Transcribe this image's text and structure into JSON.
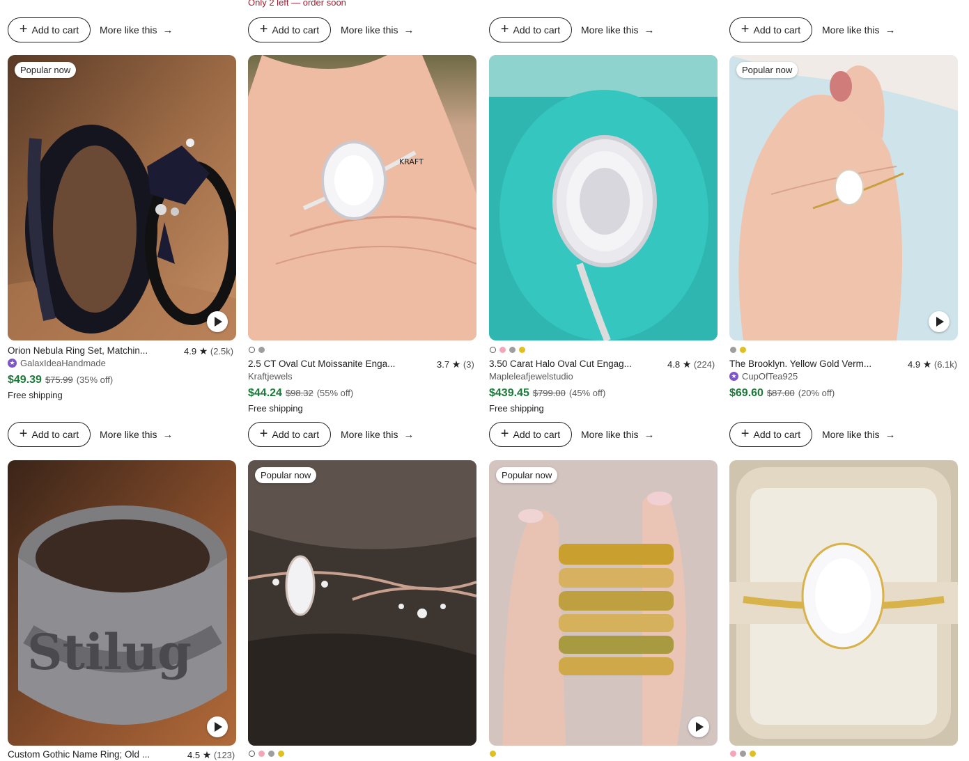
{
  "stock_note": "Only 2 left — order soon",
  "buttons": {
    "add_to_cart": "Add to cart",
    "more_like_this": "More like this"
  },
  "listings": [
    {
      "badge": "Popular now",
      "video": true,
      "swatches": [],
      "title": "Orion Nebula Ring Set, Matchin...",
      "rating": "4.9",
      "review_count": "(2.5k)",
      "shop": "GalaxIdeaHandmade",
      "star_seller": true,
      "price": "$49.39",
      "original_price": "$75.99",
      "discount": "(35% off)",
      "shipping": "Free shipping"
    },
    {
      "badge": "",
      "video": false,
      "swatches": [
        "#ffffff",
        "#9e9e9e"
      ],
      "title": "2.5 CT Oval Cut Moissanite Enga...",
      "rating": "3.7",
      "review_count": "(3)",
      "shop": "Kraftjewels",
      "star_seller": false,
      "price": "$44.24",
      "original_price": "$98.32",
      "discount": "(55% off)",
      "shipping": "Free shipping"
    },
    {
      "badge": "",
      "video": false,
      "swatches": [
        "#ffffff",
        "#f4a6b8",
        "#9e9e9e",
        "#e0c020"
      ],
      "title": "3.50 Carat Halo Oval Cut Engag...",
      "rating": "4.8",
      "review_count": "(224)",
      "shop": "Mapleleafjewelstudio",
      "star_seller": false,
      "price": "$439.45",
      "original_price": "$799.00",
      "discount": "(45% off)",
      "shipping": "Free shipping"
    },
    {
      "badge": "Popular now",
      "video": true,
      "swatches": [
        "#9e9e9e",
        "#e0c020"
      ],
      "title": "The Brooklyn. Yellow Gold Verm...",
      "rating": "4.9",
      "review_count": "(6.1k)",
      "shop": "CupOfTea925",
      "star_seller": true,
      "price": "$69.60",
      "original_price": "$87.00",
      "discount": "(20% off)",
      "shipping": ""
    },
    {
      "badge": "",
      "video": true,
      "swatches": [],
      "title": "Custom Gothic Name Ring; Old ...",
      "rating": "4.5",
      "review_count": "(123)"
    },
    {
      "badge": "Popular now",
      "video": false,
      "swatches": [
        "#ffffff",
        "#f4a6b8",
        "#9e9e9e",
        "#e0c020"
      ]
    },
    {
      "badge": "Popular now",
      "video": true,
      "swatches": [
        "#e0c020"
      ]
    },
    {
      "badge": "",
      "video": false,
      "swatches": [
        "#f4a6b8",
        "#9e9e9e",
        "#e0c020"
      ]
    }
  ],
  "colors": {
    "sale_green": "#1a7a37",
    "stock_red": "#a61a2e",
    "star_seller_purple": "#7b55c9"
  }
}
